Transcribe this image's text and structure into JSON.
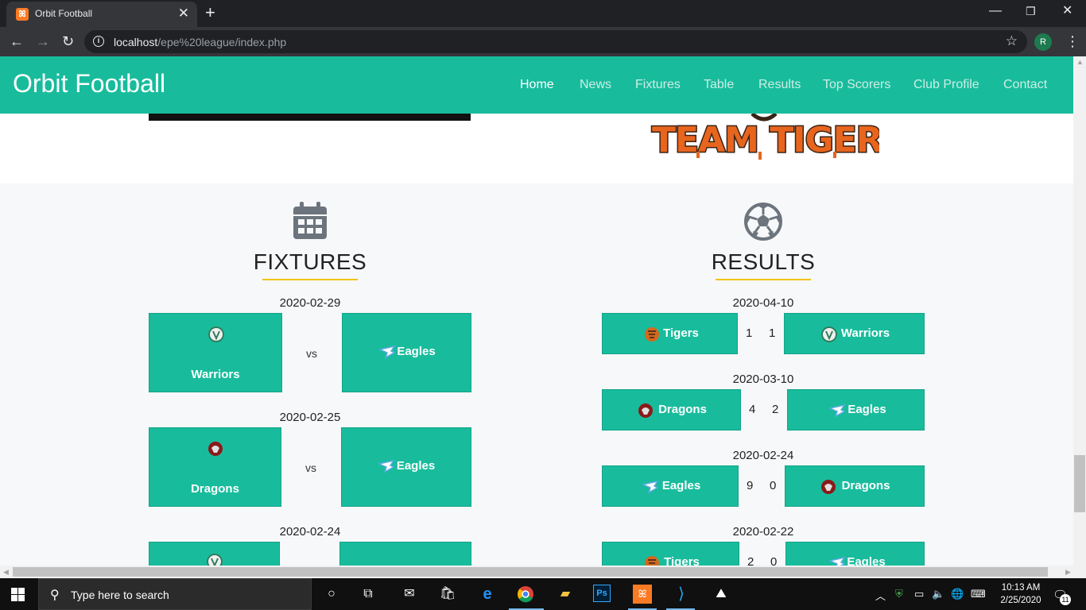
{
  "browser": {
    "tab_title": "Orbit Football",
    "tab_close": "✕",
    "new_tab": "+",
    "url_host": "localhost",
    "url_path": "/epe%20league/index.php",
    "profile_initial": "R",
    "window_controls": {
      "minimize": "—",
      "restore": "❐",
      "close": "✕"
    }
  },
  "site": {
    "brand": "Orbit Football",
    "nav": [
      {
        "label": "Home",
        "active": true
      },
      {
        "label": "News"
      },
      {
        "label": "Fixtures"
      },
      {
        "label": "Table"
      },
      {
        "label": "Results"
      },
      {
        "label": "Top Scorers"
      },
      {
        "label": "Club Profile"
      },
      {
        "label": "Contact"
      }
    ],
    "hero_logo_text": "TEAM TIGER"
  },
  "fixtures": {
    "title": "FIXTURES",
    "icon": "calendar-icon",
    "separator": "vs",
    "matches": [
      {
        "date": "2020-02-29",
        "home": "Warriors",
        "away": "Eagles"
      },
      {
        "date": "2020-02-25",
        "home": "Dragons",
        "away": "Eagles"
      },
      {
        "date": "2020-02-24",
        "home": "",
        "away": ""
      }
    ]
  },
  "results": {
    "title": "RESULTS",
    "icon": "soccer-ball-icon",
    "matches": [
      {
        "date": "2020-04-10",
        "home": "Tigers",
        "home_score": "1",
        "away_score": "1",
        "away": "Warriors"
      },
      {
        "date": "2020-03-10",
        "home": "Dragons",
        "home_score": "4",
        "away_score": "2",
        "away": "Eagles"
      },
      {
        "date": "2020-02-24",
        "home": "Eagles",
        "home_score": "9",
        "away_score": "0",
        "away": "Dragons"
      },
      {
        "date": "2020-02-22",
        "home": "Tigers",
        "home_score": "2",
        "away_score": "0",
        "away": "Eagles"
      }
    ]
  },
  "taskbar": {
    "search_placeholder": "Type here to search",
    "time": "10:13 AM",
    "date": "2/25/2020",
    "notifications": "11"
  },
  "colors": {
    "brand_green": "#18bc9c",
    "accent_yellow": "#f1c40f",
    "tiger": "#d2691e",
    "warriors": "#2e7d5b",
    "dragons": "#8b1a1a",
    "eagles": "#5aa9e6"
  }
}
